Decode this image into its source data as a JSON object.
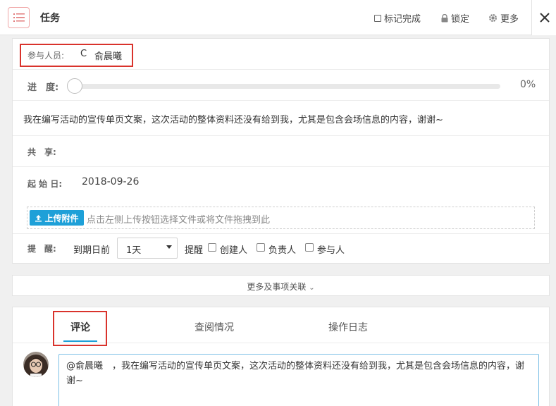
{
  "header": {
    "title": "任务",
    "mark_complete": "标记完成",
    "lock": "锁定",
    "more": "更多"
  },
  "detail": {
    "participants_label": "参与人员:",
    "participant_initial": "C",
    "participant_name": "俞晨曦",
    "progress_label": "进　度:",
    "progress_value": "0%",
    "progress_fraction": 0,
    "description": "我在编写活动的宣传单页文案，这次活动的整体资料还没有给到我，尤其是包含会场信息的内容，谢谢~",
    "share_label": "共　享:",
    "start_label": "起 始 日:",
    "start_date": "2018-09-26",
    "upload_button": "上传附件",
    "upload_hint": "点击左侧上传按钮选择文件或将文件拖拽到此",
    "remind_label": "提　醒:",
    "remind_before": "到期日前",
    "remind_select": "1天",
    "remind_word": "提醒",
    "remind_creator": "创建人",
    "remind_owner": "负责人",
    "remind_participant": "参与人"
  },
  "more_link": "更多及事项关联",
  "tabs": [
    {
      "label": "评论"
    },
    {
      "label": "查阅情况"
    },
    {
      "label": "操作日志"
    }
  ],
  "comment": {
    "text": "@俞晨曦　，我在编写活动的宣传单页文案，这次活动的整体资料还没有给到我，尤其是包含会场信息的内容，谢谢~"
  },
  "colors": {
    "accent": "#1ea0d8",
    "highlight": "#d9332c"
  }
}
